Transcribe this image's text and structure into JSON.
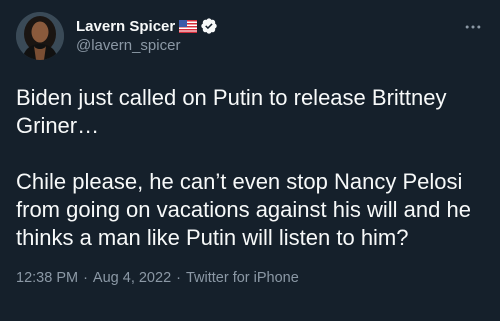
{
  "author": {
    "display_name": "Lavern Spicer",
    "handle": "@lavern_spicer",
    "flag_icon": "us-flag-icon",
    "verified_icon": "verified-badge-icon",
    "verified_color": "#1d9bf0"
  },
  "tweet": {
    "paragraph_1": "Biden just called on Putin to release Brittney Griner…",
    "paragraph_2": "Chile please, he can’t even stop Nancy Pelosi from going on vacations against his will and he thinks a man like Putin will listen to him?"
  },
  "meta": {
    "time": "12:38 PM",
    "separator": "·",
    "date": "Aug 4, 2022",
    "source": "Twitter for iPhone"
  },
  "colors": {
    "background": "#15202b",
    "text_primary": "#f7f9f9",
    "text_secondary": "#8b98a5"
  },
  "more_icon": "more-horizontal-icon"
}
